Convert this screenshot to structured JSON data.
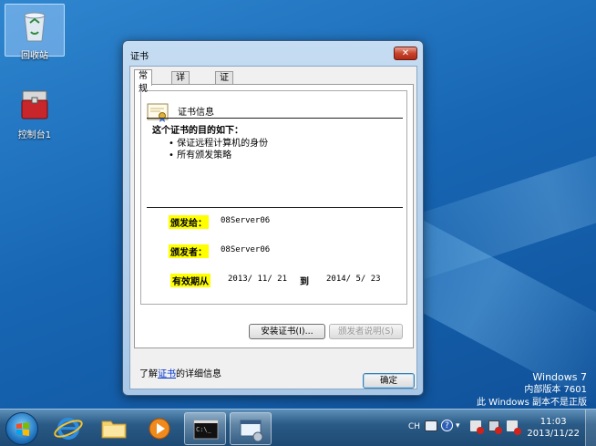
{
  "desktop": {
    "icons": [
      {
        "label": "回收站",
        "icon": "recycle-bin-icon"
      },
      {
        "label": "控制台1",
        "icon": "toolbox-icon"
      }
    ],
    "watermark": {
      "line1": "Windows 7",
      "line2": "内部版本 7601",
      "line3": "此 Windows 副本不是正版"
    }
  },
  "taskbar": {
    "tray": {
      "lang": "CH",
      "time": "11:03",
      "date": "2013/11/22"
    }
  },
  "dialog": {
    "title": "证书",
    "close_label": "✕",
    "tabs": [
      "常规",
      "详细信息",
      "证书路径"
    ],
    "cert_info_title": "证书信息",
    "purpose_heading": "这个证书的目的如下：",
    "purposes": [
      "• 保证远程计算机的身份",
      "• 所有颁发策略"
    ],
    "issued_to_label": "颁发给：",
    "issued_to": "08Server06",
    "issued_by_label": "颁发者：",
    "issued_by": "08Server06",
    "valid_label": "有效期从",
    "valid_from": "2013/  11/  21",
    "valid_to_label": "到",
    "valid_to": "2014/  5/  23",
    "install_btn": "安装证书(I)...",
    "issuer_stmt_btn": "颁发者说明(S)",
    "learn_prefix": "了解",
    "learn_link": "证书",
    "learn_suffix": "的详细信息",
    "ok_btn": "确定"
  },
  "colors": {
    "highlight": "#ffff00",
    "link": "#0033cc",
    "close": "#c8442c"
  }
}
